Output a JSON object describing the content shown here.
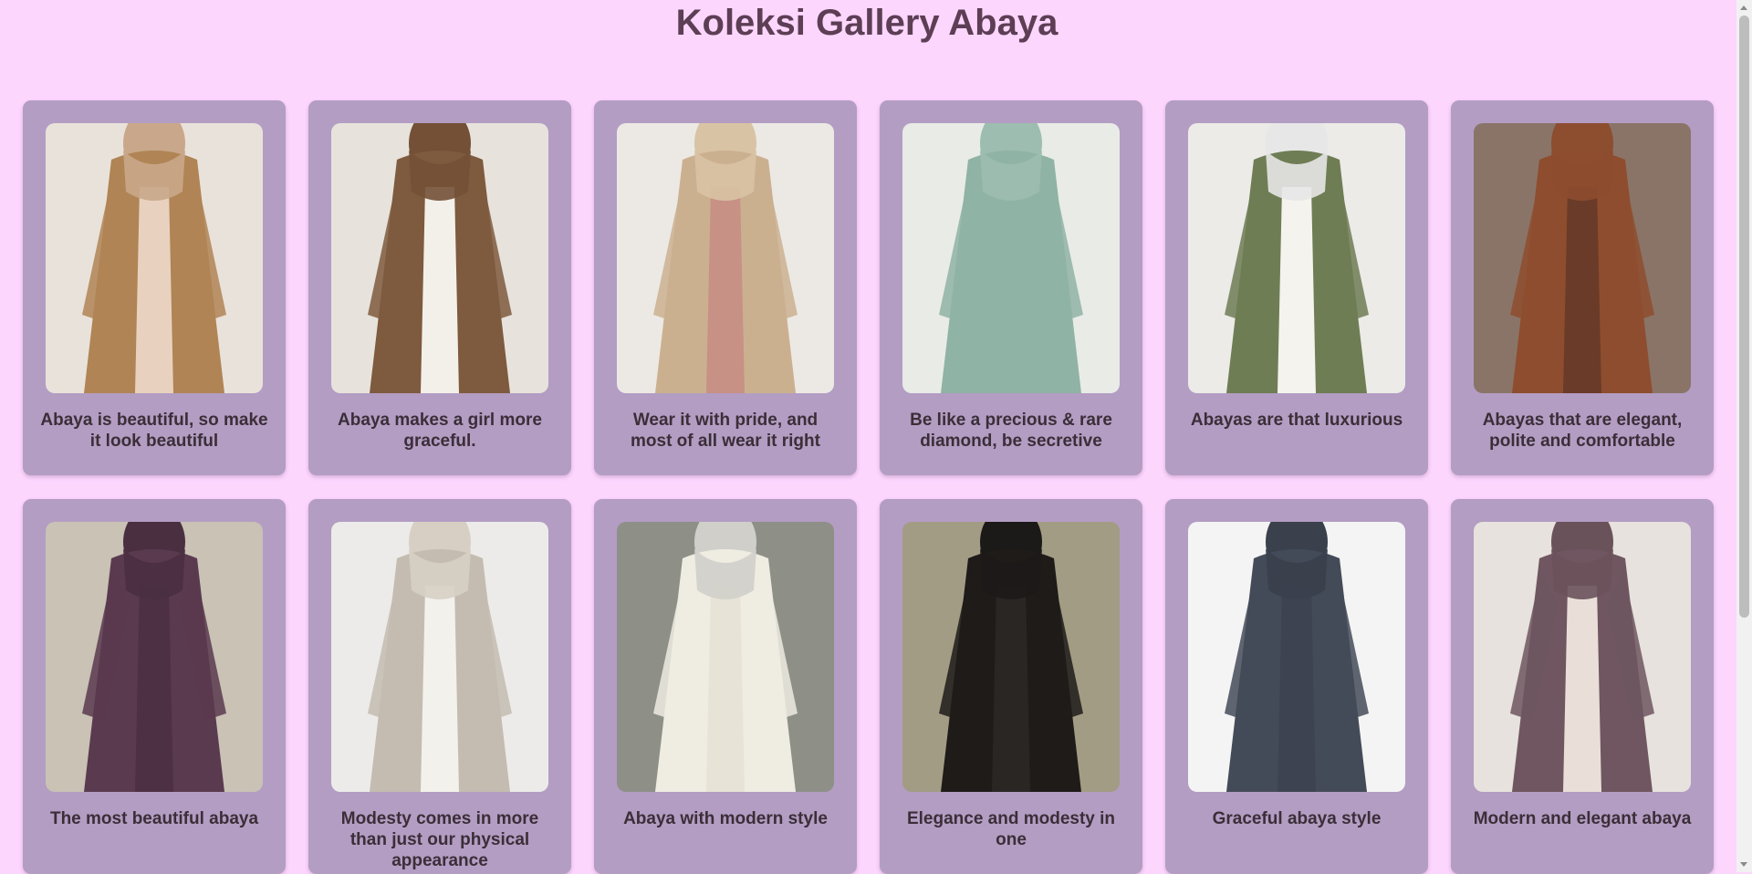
{
  "title": "Koleksi Gallery Abaya",
  "cards": [
    {
      "caption": "Abaya is beautiful, so make it look beautiful",
      "bg": "#e9e2da",
      "robe": "#b08455",
      "inner": "#e8d2bf",
      "scarf": "#c9a78a"
    },
    {
      "caption": "Abaya makes a girl more graceful.",
      "bg": "#e7e3dc",
      "robe": "#7e5a3e",
      "inner": "#f3f0ea",
      "scarf": "#735036"
    },
    {
      "caption": "Wear it with pride, and most of all wear it right",
      "bg": "#ece9e4",
      "robe": "#cbb090",
      "inner": "#c79185",
      "scarf": "#d8c3a4"
    },
    {
      "caption": "Be like a precious & rare diamond, be secretive",
      "bg": "#e9ebe7",
      "robe": "#8fb3a4",
      "inner": "#8fb3a4",
      "scarf": "#9cbdaf"
    },
    {
      "caption": "Abayas are that luxurious",
      "bg": "#ecebe8",
      "robe": "#6f7d54",
      "inner": "#f4f3ee",
      "scarf": "#e7e7e7"
    },
    {
      "caption": "Abayas that are elegant, polite and comfortable",
      "bg": "#8a7468",
      "robe": "#8e4d2e",
      "inner": "#6a3b28",
      "scarf": "#8d4d2f"
    },
    {
      "caption": "The most beautiful abaya",
      "bg": "#c9c2b5",
      "robe": "#5a3a4f",
      "inner": "#4d3043",
      "scarf": "#4a2f41"
    },
    {
      "caption": "Modesty comes in more than just our physical appearance",
      "bg": "#ecebe9",
      "robe": "#c4bcb0",
      "inner": "#f3f1ec",
      "scarf": "#d7cfc4"
    },
    {
      "caption": "Abaya with modern style",
      "bg": "#8e9088",
      "robe": "#efece2",
      "inner": "#e7e3d6",
      "scarf": "#d0cfca"
    },
    {
      "caption": "Elegance and modesty in one",
      "bg": "#a39c84",
      "robe": "#1e1b19",
      "inner": "#2a2624",
      "scarf": "#1c1a18"
    },
    {
      "caption": "Graceful abaya style",
      "bg": "#f4f4f4",
      "robe": "#444b58",
      "inner": "#3d4350",
      "scarf": "#3a404c"
    },
    {
      "caption": "Modern and elegant abaya",
      "bg": "#e7e2dd",
      "robe": "#6f5660",
      "inner": "#e9dfd8",
      "scarf": "#6a525b"
    }
  ]
}
